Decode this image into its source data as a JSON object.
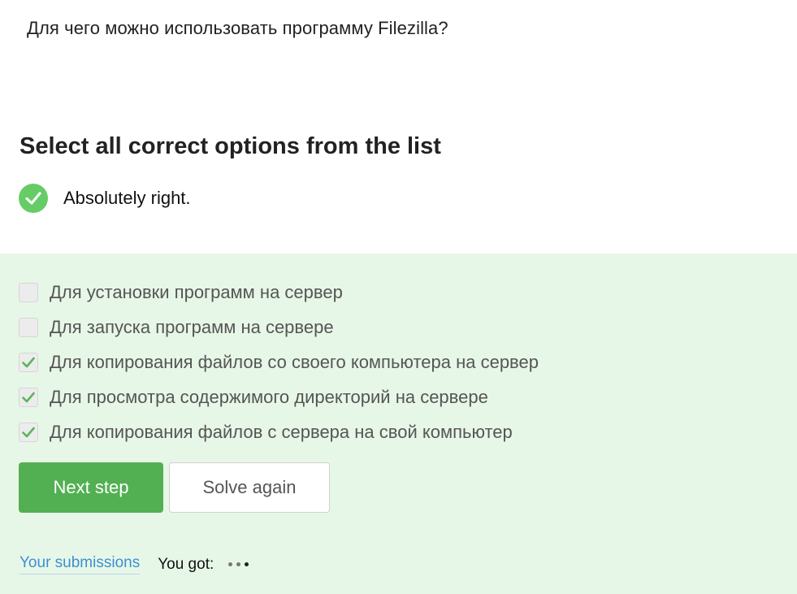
{
  "question": "Для чего можно использовать программу Filezilla?",
  "instruction": "Select all correct options from the list",
  "feedback": {
    "text": "Absolutely right.",
    "icon": "check-circle-icon",
    "color": "#66cc66"
  },
  "options": [
    {
      "label": "Для установки программ на сервер",
      "checked": false
    },
    {
      "label": "Для запуска программ на сервере",
      "checked": false
    },
    {
      "label": "Для копирования файлов со своего компьютера на сервер",
      "checked": true
    },
    {
      "label": "Для просмотра содержимого директорий на сервере",
      "checked": true
    },
    {
      "label": "Для копирования файлов с сервера на свой компьютер",
      "checked": true
    }
  ],
  "buttons": {
    "next": "Next step",
    "again": "Solve again"
  },
  "footer": {
    "submissions": "Your submissions",
    "you_got": "You got:"
  },
  "colors": {
    "accent": "#52b052",
    "answer_bg": "#e7f7e7",
    "link": "#3d8fd4"
  }
}
